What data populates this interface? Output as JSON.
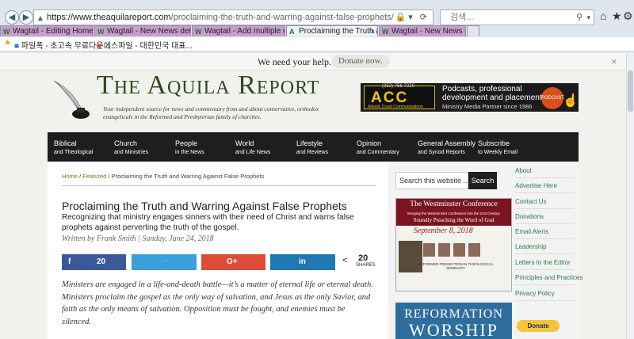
{
  "browser": {
    "url_domain": "https://www.theaquilareport.com",
    "url_path": "/proclaiming-the-truth-and-warring-against-false-prophets/",
    "search_placeholder": "검색...",
    "tabs": [
      {
        "label": "Wagtail - Editing Home page...",
        "color": "#c79fcc"
      },
      {
        "label": "Wagtail - New News detail pa...",
        "color": "#c79fcc"
      },
      {
        "label": "Wagtail - Add multiple docu...",
        "color": "#c79fcc"
      },
      {
        "label": "Proclaiming the Truth and ...",
        "color": "#eef2f6"
      },
      {
        "label": "Wagtail - New News detail pa...",
        "color": "#c79fcc"
      }
    ],
    "favorites": [
      {
        "label": "파일폭 - 초고속 무료다운..."
      },
      {
        "label": "에스파일 - 대한민국 대표..."
      }
    ]
  },
  "notice": {
    "text": "We need your help.",
    "button": "Donate now.",
    "close": "×"
  },
  "masthead": {
    "title": "The Aquila Report",
    "tagline": "Your independent source for news and commentary from and about conservative, orthodox evangelicals in the Reformed and Presbyterian family of churches."
  },
  "ad": {
    "phone": "(252) 756-7220",
    "brand": "ACC",
    "brand_sub": "Atlantic Coast Communications",
    "line1": "Podcasts, professional",
    "line2": "development and placement",
    "line3": "Ministry Media Partner since 1986",
    "badge": "PODCAST"
  },
  "nav": [
    {
      "title": "Biblical",
      "sub": "and Theological"
    },
    {
      "title": "Church",
      "sub": "and Ministries"
    },
    {
      "title": "People",
      "sub": "in the News"
    },
    {
      "title": "World",
      "sub": "and Life News"
    },
    {
      "title": "Lifestyle",
      "sub": "and Reviews"
    },
    {
      "title": "Opinion",
      "sub": "and Commentary"
    },
    {
      "title": "General Assembly",
      "sub": "and Synod Reports"
    },
    {
      "title": "Subscribe",
      "sub": "to Weekly Email"
    }
  ],
  "breadcrumb": {
    "home": "Home",
    "sep1": " / ",
    "featured": "Featured",
    "sep2": " / ",
    "current": "Proclaiming the Truth and Warring Against False Prophets"
  },
  "article": {
    "title": "Proclaiming the Truth and Warring Against False Prophets",
    "subtitle": "Recognizing that ministry engages sinners with their need of Christ and warns false prophets against perverting the truth of the gospel.",
    "byline": "Written by Frank Smith | Sunday, June 24, 2018",
    "body": "Ministers are engaged in a life-and-death battle—it’s a matter of eternal life or eternal death. Ministers proclaim the gospel as the only way of salvation, and Jesus as the only Savior, and faith as the only means of salvation. Opposition must be fought, and enemies must be silenced."
  },
  "share": {
    "facebook": "f",
    "facebook_count": "20",
    "twitter": "🐦",
    "googleplus": "G+",
    "linkedin": "in",
    "total": "20",
    "total_label": "SHARES"
  },
  "sidebar": {
    "search_placeholder": "Search this website ...",
    "search_button": "Search",
    "wconf": {
      "title": "The Westminster Conference",
      "tiny": "Bringing the Westminster Confession into the 21st Century",
      "tagline": "Soundly Preaching the Word of God",
      "date": "September 8, 2018",
      "seminary": "REFORMED PRESBYTERIAN THEOLOGICAL SEMINARY"
    },
    "reform": {
      "line1": "REFORMATION",
      "line2": "WORSHIP"
    },
    "links": [
      "About",
      "Advertise Here",
      "Contact Us",
      "Donations",
      "Email Alerts",
      "Leadership",
      "Letters to the Editor",
      "Principles and Practices",
      "Privacy Policy"
    ],
    "paypal": "Donate"
  }
}
